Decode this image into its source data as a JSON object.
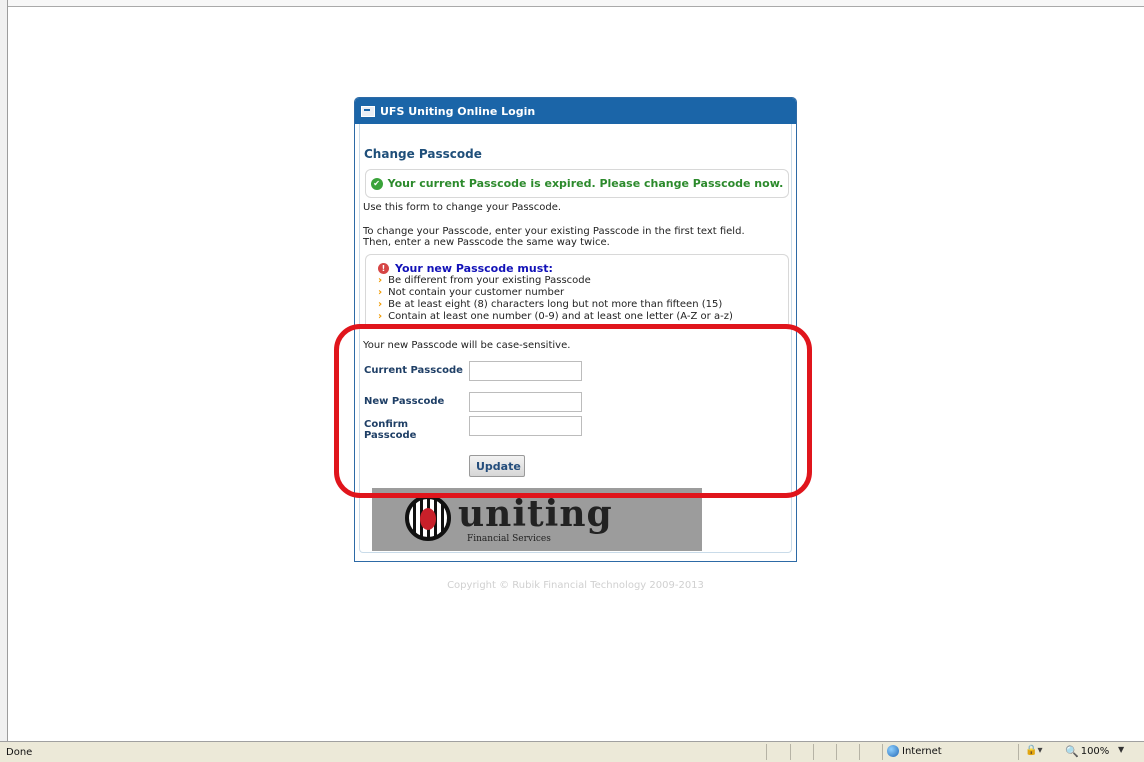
{
  "panel": {
    "header_title": "UFS Uniting Online Login",
    "title": "Change Passcode",
    "status_message": "Your current Passcode is expired. Please change Passcode now.",
    "intro": "Use this form to change your Passcode.",
    "instructions_line1": "To change your Passcode, enter your existing Passcode in the first text field.",
    "instructions_line2": "Then, enter a new Passcode the same way twice.",
    "rules_heading": "Your new Passcode must:",
    "rules": [
      "Be different from your existing Passcode",
      "Not contain your customer number",
      "Be at least eight (8) characters long but not more than fifteen (15)",
      "Contain at least one number (0-9) and at least one letter (A-Z or a-z)"
    ],
    "case_note": "Your new Passcode will be case-sensitive."
  },
  "form": {
    "current_label": "Current Passcode",
    "new_label": "New Passcode",
    "confirm_label_line1": "Confirm",
    "confirm_label_line2": "Passcode",
    "current_value": "",
    "new_value": "",
    "confirm_value": "",
    "update_label": "Update"
  },
  "logo": {
    "wordmark": "uniting",
    "subtitle": "Financial Services"
  },
  "footer": {
    "copyright": "Copyright © Rubik Financial Technology 2009-2013"
  },
  "statusbar": {
    "status": "Done",
    "zone": "Internet",
    "zoom": "100%"
  },
  "colors": {
    "header_blue": "#1b65a8",
    "success_green": "#2c8a2c",
    "rules_blue": "#1212b8",
    "highlight_red": "#e0151c"
  },
  "icons": {
    "header": "window-icon",
    "status": "check-circle-icon",
    "rules": "alert-circle-icon",
    "bullet": "chevron-right-icon",
    "zone": "globe-icon",
    "zoom": "magnifier-icon"
  }
}
